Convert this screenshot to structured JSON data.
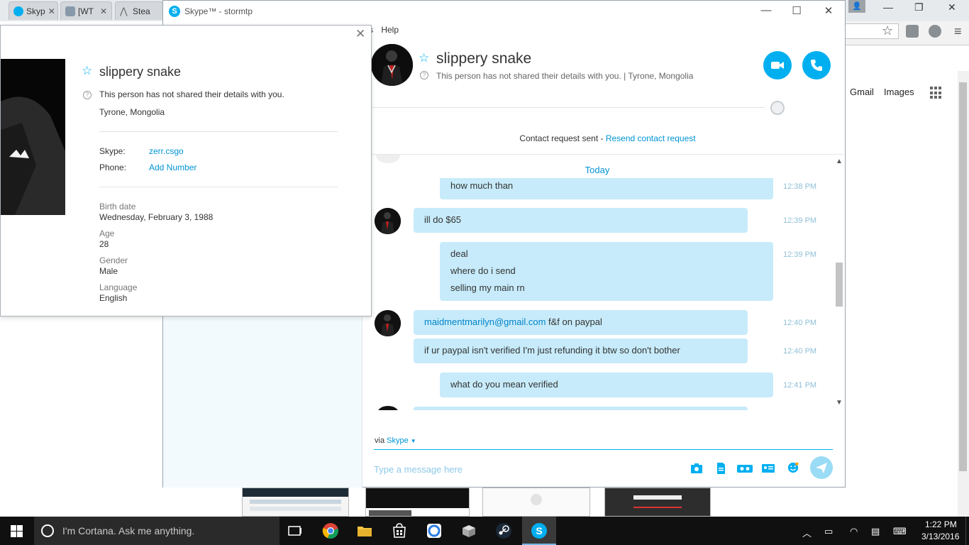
{
  "browser": {
    "tabs": [
      {
        "label": "Skyp",
        "icon": "skype-icon",
        "color": "#00aff0"
      },
      {
        "label": "[WT",
        "icon": "shield-icon",
        "color": "#8899aa"
      },
      {
        "label": "Stea",
        "icon": "steam-icon",
        "color": "#666666"
      }
    ],
    "gmail": "Gmail",
    "images": "Images"
  },
  "skype": {
    "window_title": "Skype™ - stormtp",
    "menu": [
      "s",
      "Help"
    ],
    "accent": "#00aff0",
    "conversation": {
      "name": "slippery snake",
      "subtitle": "This person has not shared their details with you.  |  Tyrone, Mongolia",
      "contact_request": "Contact request sent - ",
      "resend_link": "Resend contact request",
      "today_label": "Today"
    },
    "messages": [
      {
        "id": "m1",
        "lines": [
          "how much than"
        ],
        "time": "12:38 PM",
        "from": "me"
      },
      {
        "id": "m2",
        "lines": [
          "ill do $65"
        ],
        "time": "12:39 PM",
        "from": "them"
      },
      {
        "id": "m3",
        "lines": [
          "deal",
          "where do i send",
          "selling my main rn"
        ],
        "time": "12:39 PM",
        "from": "me"
      },
      {
        "id": "m4",
        "link": "maidmentmarilyn@gmail.com",
        "text": " f&f on paypal",
        "time": "12:40 PM",
        "from": "them"
      },
      {
        "id": "m5",
        "lines": [
          "if ur paypal isn't verified I'm just refunding it btw so don't bother"
        ],
        "time": "12:40 PM",
        "from": "them"
      },
      {
        "id": "m6",
        "lines": [
          "what do you mean verified"
        ],
        "time": "12:41 PM",
        "from": "me"
      }
    ],
    "composer": {
      "via": "via ",
      "via_link": "Skype",
      "placeholder": "Type a message here"
    }
  },
  "contact_card": {
    "name": "slippery snake",
    "privacy_note": "This person has not shared their details with you.",
    "location": "Tyrone, Mongolia",
    "skype_label": "Skype:",
    "skype_value": "zerr.csgo",
    "phone_label": "Phone:",
    "phone_value": "Add Number",
    "birth_label": "Birth date",
    "birth_value": "Wednesday, February 3, 1988",
    "age_label": "Age",
    "age_value": "28",
    "gender_label": "Gender",
    "gender_value": "Male",
    "language_label": "Language",
    "language_value": "English"
  },
  "taskbar": {
    "cortana_placeholder": "I'm Cortana. Ask me anything.",
    "time": "1:22 PM",
    "date": "3/13/2016"
  }
}
